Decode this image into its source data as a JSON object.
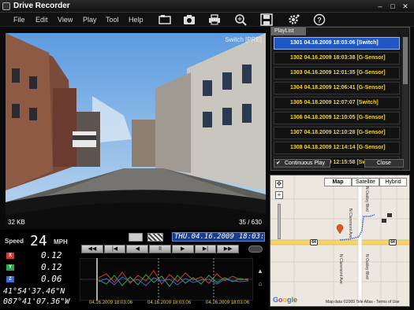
{
  "window": {
    "title": "Drive Recorder",
    "buttons": [
      "–",
      "□",
      "✕"
    ]
  },
  "menu": [
    "File",
    "Edit",
    "View",
    "Play",
    "Tool",
    "Help"
  ],
  "toolbar_icons": [
    "open-folder-icon",
    "camera-icon",
    "print-icon",
    "zoom-icon",
    "save-icon",
    "settings-icon",
    "help-icon"
  ],
  "video": {
    "mode": "Switch [PRE]",
    "size": "32 KB",
    "frame": "35 / 630"
  },
  "info": {
    "speed_label": "Speed",
    "speed": "24",
    "speed_unit": "MPH",
    "g": [
      {
        "axis": "X",
        "value": "0.12",
        "color": "#d83a2a"
      },
      {
        "axis": "Y",
        "value": "0.12",
        "color": "#2aa84a"
      },
      {
        "axis": "Z",
        "value": "0.06",
        "color": "#3a6ad8"
      }
    ],
    "lat": "41°54'37.46\"N",
    "lon": "087°41'07.36\"W"
  },
  "datetime": {
    "date": "THU.04.16.2009",
    "time": "18:03:07"
  },
  "transport": [
    "◀◀",
    "|◀",
    "◀",
    "II",
    "▶",
    "▶|",
    "▶▶"
  ],
  "graph": {
    "dates": [
      "04.16.2009 18:03:06",
      "04.16.2009 18:03:06",
      "04.16.2009 18:03:06"
    ]
  },
  "playlist": {
    "tab": "PlayList",
    "items": [
      {
        "text": "1301  04.16.2009 18:03:06 [Switch]",
        "active": true
      },
      {
        "text": "1302  04.16.2009 18:03:38 [G-Sensor]",
        "active": false
      },
      {
        "text": "1303  04.16.2009 12:01:35 [G-Sensor]",
        "active": false
      },
      {
        "text": "1304  04.18.2009 12:06:41 [G-Sensor]",
        "active": false
      },
      {
        "text": "1305  04.18.2009 12:07:07 [Switch]",
        "active": false
      },
      {
        "text": "1306  04.18.2009 12:10:05 [G-Sensor]",
        "active": false
      },
      {
        "text": "1307  04.18.2009 12:10:28 [G-Sensor]",
        "active": false
      },
      {
        "text": "1308  04.18.2009 12:14:14 [G-Sensor]",
        "active": false
      },
      {
        "text": "1309  04.18.2009 12:15:58 [Switch]",
        "active": false
      }
    ],
    "continuous_play": "Continuous Play",
    "close": "Close"
  },
  "map": {
    "tabs": [
      "Map",
      "Satellite",
      "Hybrid"
    ],
    "streets": [
      "N Claremont Ave",
      "N Claremont Ave",
      "N Oakley Blvd",
      "N Oakley Blvd"
    ],
    "route": "64",
    "copyright": "Map data ©2009 Tele Atlas - Terms of Use",
    "logo_letters": [
      "G",
      "o",
      "o",
      "g",
      "l",
      "e"
    ]
  }
}
